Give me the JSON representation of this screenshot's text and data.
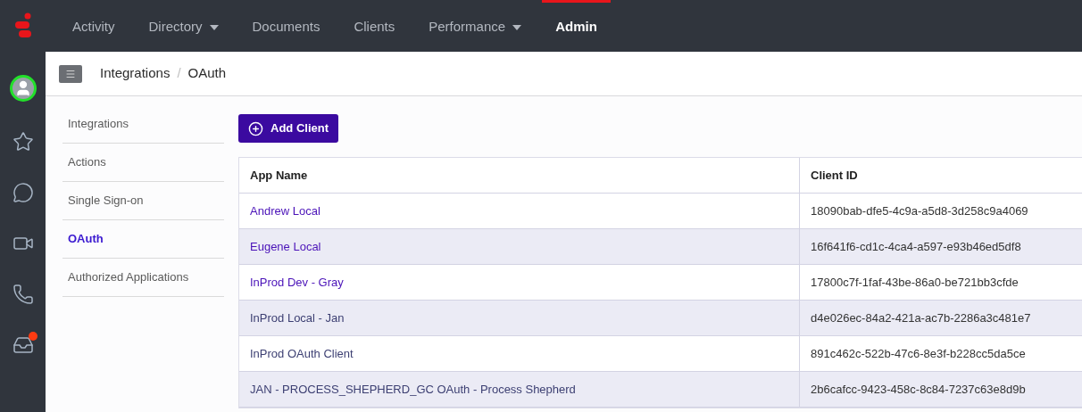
{
  "nav": [
    {
      "label": "Activity",
      "has_menu": false,
      "selected": false
    },
    {
      "label": "Directory",
      "has_menu": true,
      "selected": false
    },
    {
      "label": "Documents",
      "has_menu": false,
      "selected": false
    },
    {
      "label": "Clients",
      "has_menu": false,
      "selected": false
    },
    {
      "label": "Performance",
      "has_menu": true,
      "selected": false
    },
    {
      "label": "Admin",
      "has_menu": false,
      "selected": true
    }
  ],
  "rail": [
    {
      "kind": "avatar",
      "badge": false
    },
    {
      "kind": "star",
      "badge": false
    },
    {
      "kind": "chat",
      "badge": false
    },
    {
      "kind": "video",
      "badge": false
    },
    {
      "kind": "phone",
      "badge": false
    },
    {
      "kind": "inbox",
      "badge": true
    }
  ],
  "breadcrumb": {
    "items": [
      "Integrations",
      "OAuth"
    ],
    "separator": "/"
  },
  "sidebar": {
    "items": [
      {
        "label": "Integrations",
        "selected": false
      },
      {
        "label": "Actions",
        "selected": false
      },
      {
        "label": "Single Sign-on",
        "selected": false
      },
      {
        "label": "OAuth",
        "selected": true
      },
      {
        "label": "Authorized Applications",
        "selected": false
      }
    ]
  },
  "add_button": "Add Client",
  "table": {
    "columns": [
      "App Name",
      "Client ID"
    ],
    "rows": [
      {
        "name": "Andrew Local",
        "visited": false,
        "client_id": "18090bab-dfe5-4c9a-a5d8-3d258c9a4069"
      },
      {
        "name": "Eugene Local",
        "visited": false,
        "client_id": "16f641f6-cd1c-4ca4-a597-e93b46ed5df8"
      },
      {
        "name": "InProd Dev - Gray",
        "visited": false,
        "client_id": "17800c7f-1faf-43be-86a0-be721bb3cfde"
      },
      {
        "name": "InProd Local - Jan",
        "visited": true,
        "client_id": "d4e026ec-84a2-421a-ac7b-2286a3c481e7"
      },
      {
        "name": "InProd OAuth Client",
        "visited": true,
        "client_id": "891c462c-522b-47c6-8e3f-b228cc5da5ce"
      },
      {
        "name": "JAN - PROCESS_SHEPHERD_GC OAuth - Process Shepherd",
        "visited": true,
        "client_id": "2b6cafcc-9423-458c-8c84-7237c63e8d9b"
      }
    ]
  }
}
